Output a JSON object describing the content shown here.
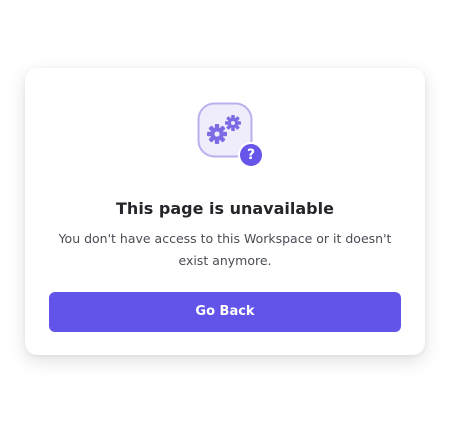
{
  "dialog": {
    "title": "This page is unavailable",
    "message": "You don't have access to this Workspace or it doesn't exist anymore.",
    "button_label": "Go Back",
    "badge_glyph": "?"
  },
  "icons": {
    "main": "gears-icon",
    "badge": "question-mark-icon"
  },
  "colors": {
    "accent": "#6354e9",
    "icon_tile_bg": "#efecfb",
    "icon_tile_border": "#b9b0ee",
    "gear": "#7b6ce6",
    "title_text": "#25262b",
    "body_text": "#4a4d55"
  }
}
